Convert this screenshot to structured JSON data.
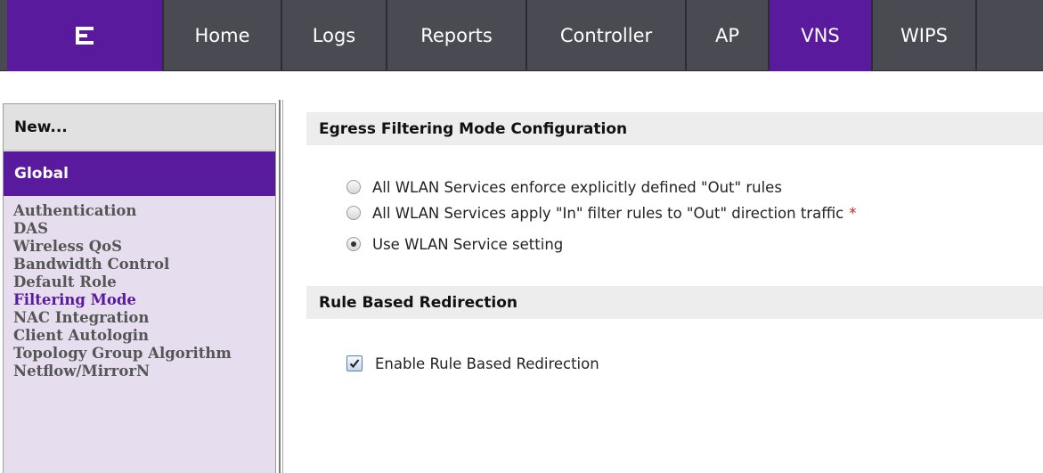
{
  "nav": {
    "tabs": [
      {
        "label": "Home"
      },
      {
        "label": "Logs"
      },
      {
        "label": "Reports"
      },
      {
        "label": "Controller"
      },
      {
        "label": "AP"
      },
      {
        "label": "VNS",
        "active": true
      },
      {
        "label": "WIPS"
      }
    ],
    "logo_icon": "extreme-networks-logo-icon",
    "active_color": "#5a1a9e",
    "bar_color": "#4a4a52"
  },
  "sidebar": {
    "new_label": "New...",
    "global_label": "Global",
    "items": [
      {
        "label": "Authentication"
      },
      {
        "label": "DAS"
      },
      {
        "label": "Wireless QoS"
      },
      {
        "label": "Bandwidth Control"
      },
      {
        "label": "Default Role"
      },
      {
        "label": "Filtering Mode",
        "active": true
      },
      {
        "label": "NAC Integration"
      },
      {
        "label": "Client Autologin"
      },
      {
        "label": "Topology Group Algorithm"
      },
      {
        "label": "Netflow/MirrorN"
      }
    ]
  },
  "main": {
    "egress": {
      "title": "Egress Filtering Mode Configuration",
      "options": [
        {
          "label": "All WLAN Services enforce explicitly defined \"Out\" rules",
          "checked": false
        },
        {
          "label": "All WLAN Services apply \"In\" filter rules to \"Out\" direction traffic",
          "checked": false,
          "required_mark": "*"
        },
        {
          "label": "Use WLAN Service setting",
          "checked": true
        }
      ]
    },
    "redirection": {
      "title": "Rule Based Redirection",
      "checkbox_label": "Enable Rule Based Redirection",
      "checked": true
    }
  }
}
